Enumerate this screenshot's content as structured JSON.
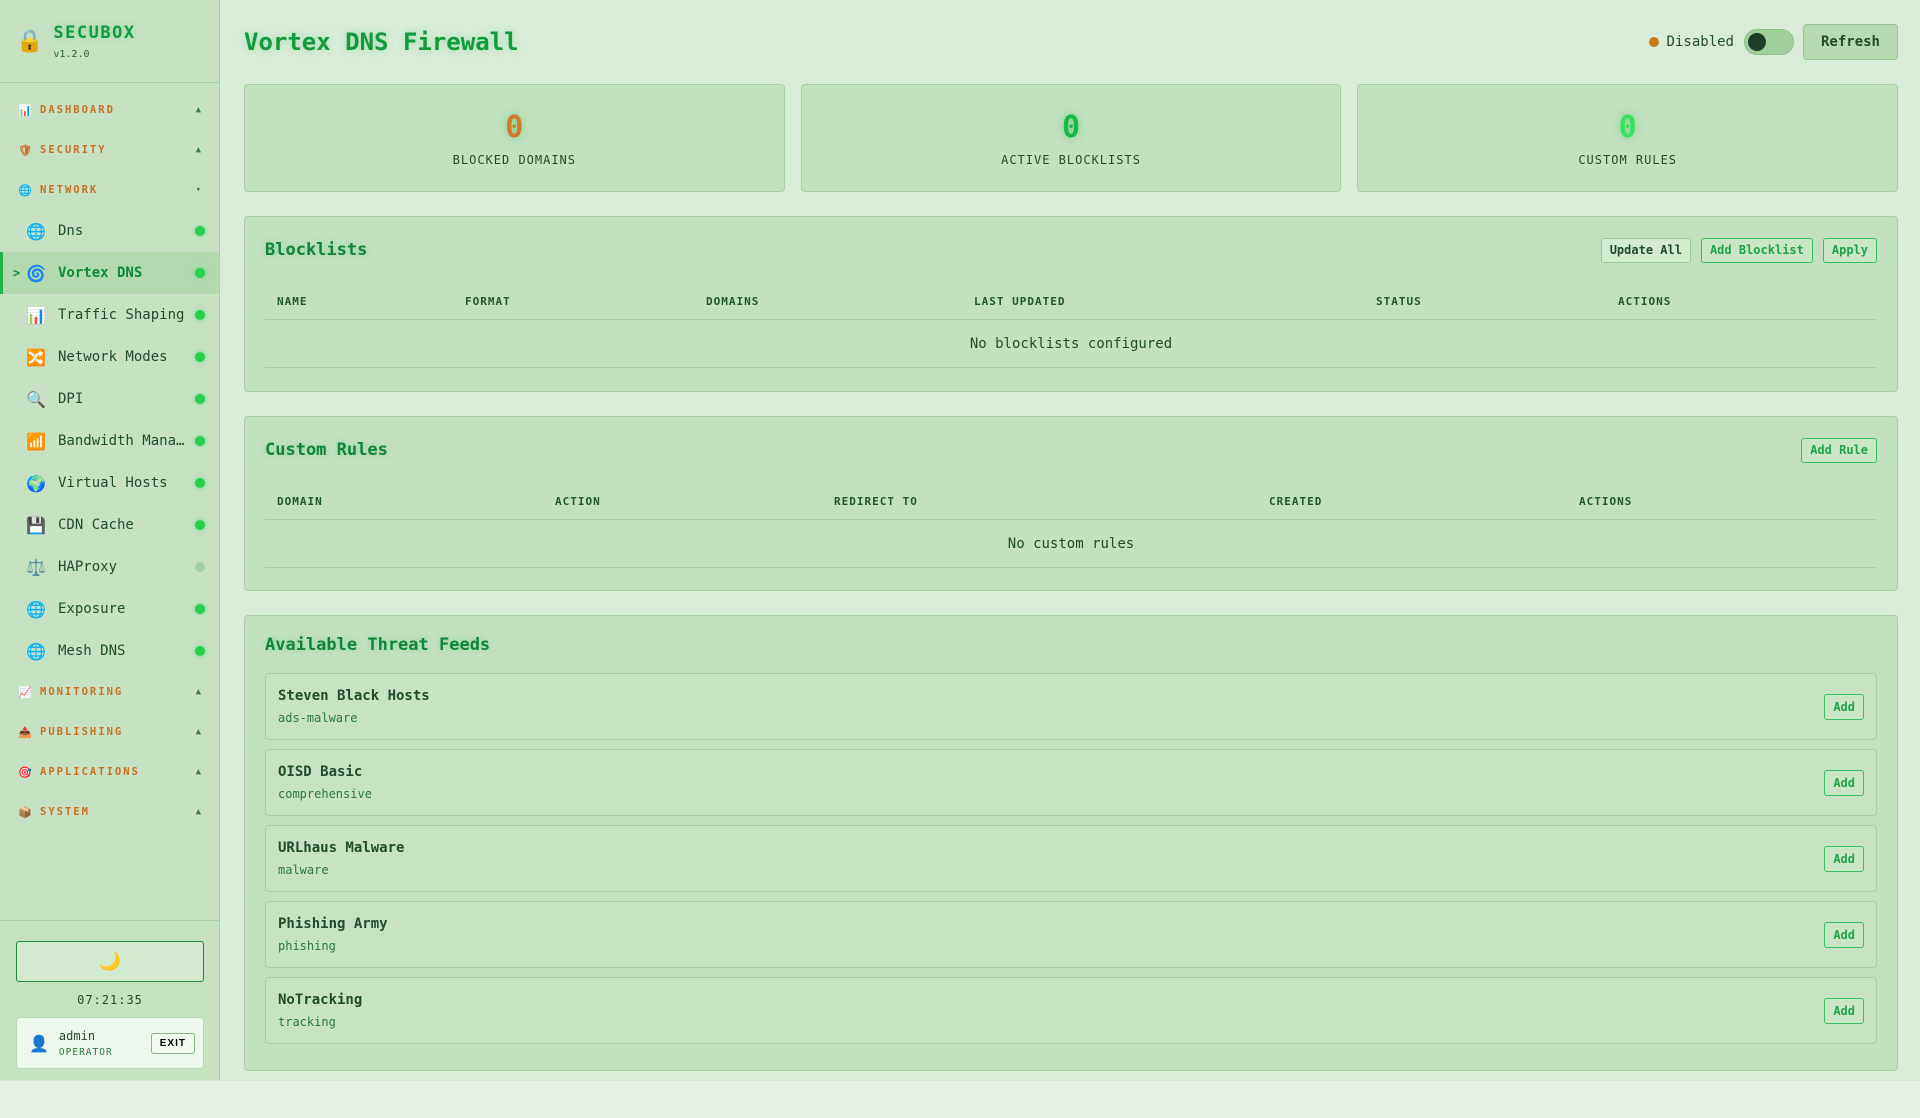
{
  "brand": {
    "name": "SECUBOX",
    "version": "v1.2.0"
  },
  "sidebar": {
    "sections": [
      {
        "icon": "📊",
        "label": "DASHBOARD",
        "chev": "▲"
      },
      {
        "icon": "🛡",
        "label": "SECURITY",
        "chev": "▲"
      },
      {
        "icon": "🌐",
        "label": "NETWORK",
        "chev": "▾"
      },
      {
        "icon": "📈",
        "label": "MONITORING",
        "chev": "▲"
      },
      {
        "icon": "📤",
        "label": "PUBLISHING",
        "chev": "▲"
      },
      {
        "icon": "🎯",
        "label": "APPLICATIONS",
        "chev": "▲"
      },
      {
        "icon": "📦",
        "label": "SYSTEM",
        "chev": "▲"
      }
    ],
    "network_items": [
      {
        "icon": "🌐",
        "label": "Dns"
      },
      {
        "icon": "🌀",
        "label": "Vortex DNS"
      },
      {
        "icon": "📊",
        "label": "Traffic Shaping"
      },
      {
        "icon": "🔀",
        "label": "Network Modes"
      },
      {
        "icon": "🔍",
        "label": "DPI"
      },
      {
        "icon": "📶",
        "label": "Bandwidth Manager"
      },
      {
        "icon": "🌍",
        "label": "Virtual Hosts"
      },
      {
        "icon": "💾",
        "label": "CDN Cache"
      },
      {
        "icon": "⚖️",
        "label": "HAProxy"
      },
      {
        "icon": "🌐",
        "label": "Exposure"
      },
      {
        "icon": "🌐",
        "label": "Mesh DNS"
      }
    ],
    "active_caret": ">",
    "theme_icon": "🌙",
    "clock": "07:21:35",
    "user": {
      "name": "admin",
      "role": "OPERATOR",
      "exit": "EXIT"
    }
  },
  "header": {
    "title": "Vortex DNS Firewall",
    "status": "Disabled",
    "refresh": "Refresh"
  },
  "stats": [
    {
      "value": "0",
      "label": "BLOCKED DOMAINS",
      "color": "#d4782a"
    },
    {
      "value": "0",
      "label": "ACTIVE BLOCKLISTS",
      "color": "#18b845"
    },
    {
      "value": "0",
      "label": "CUSTOM RULES",
      "color": "#37e05f"
    }
  ],
  "blocklists": {
    "title": "Blocklists",
    "buttons": {
      "update_all": "Update All",
      "add": "Add Blocklist",
      "apply": "Apply"
    },
    "columns": [
      "NAME",
      "FORMAT",
      "DOMAINS",
      "LAST UPDATED",
      "STATUS",
      "ACTIONS"
    ],
    "empty": "No blocklists configured"
  },
  "custom_rules": {
    "title": "Custom Rules",
    "add": "Add Rule",
    "columns": [
      "DOMAIN",
      "ACTION",
      "REDIRECT TO",
      "CREATED",
      "ACTIONS"
    ],
    "empty": "No custom rules"
  },
  "threat_feeds": {
    "title": "Available Threat Feeds",
    "add_label": "Add",
    "items": [
      {
        "name": "Steven Black Hosts",
        "category": "ads-malware"
      },
      {
        "name": "OISD Basic",
        "category": "comprehensive"
      },
      {
        "name": "URLhaus Malware",
        "category": "malware"
      },
      {
        "name": "Phishing Army",
        "category": "phishing"
      },
      {
        "name": "NoTracking",
        "category": "tracking"
      }
    ]
  }
}
